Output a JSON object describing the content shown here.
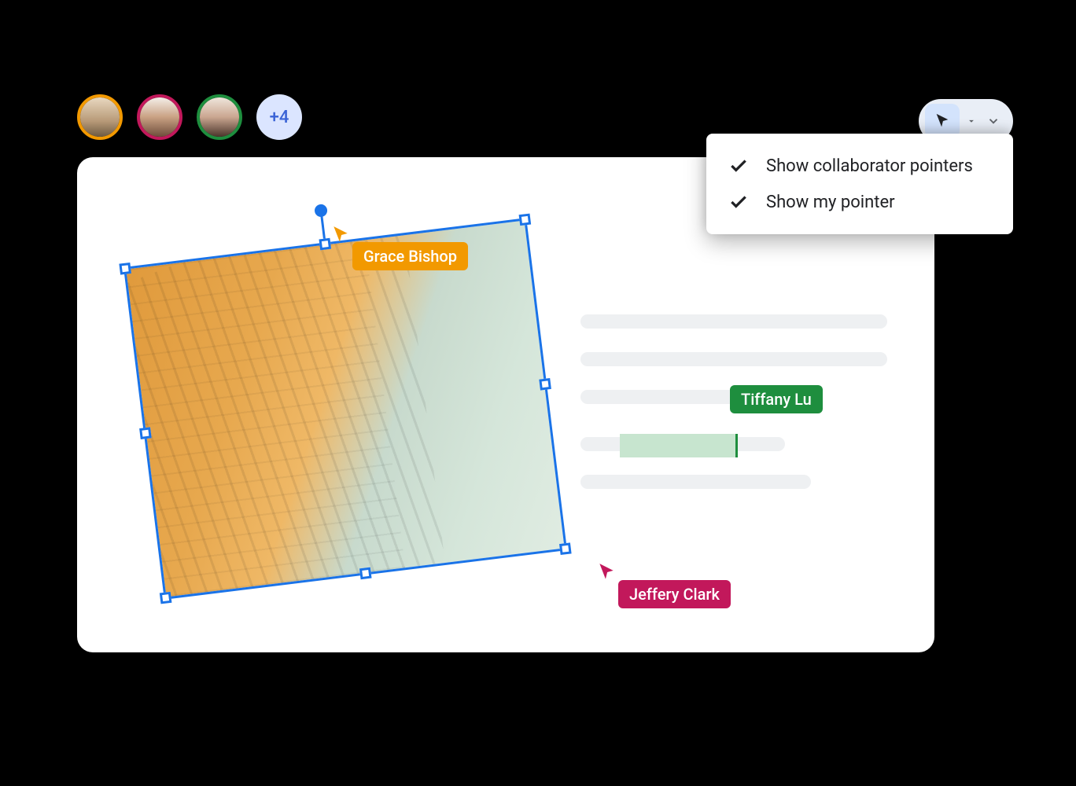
{
  "avatars": {
    "colors": [
      "#f29900",
      "#c2185b",
      "#1e8e3e"
    ],
    "overflow_label": "+4"
  },
  "toolbar": {
    "pointer_tool": "pointer",
    "dropdown": {
      "items": [
        {
          "label": "Show collaborator pointers",
          "checked": true
        },
        {
          "label": "Show my pointer",
          "checked": true
        }
      ]
    }
  },
  "collaborators": {
    "grace": {
      "name": "Grace Bishop",
      "color": "#f29900"
    },
    "tiffany": {
      "name": "Tiffany Lu",
      "color": "#1e8e3e"
    },
    "jeffery": {
      "name": "Jeffery Clark",
      "color": "#c2185b"
    }
  }
}
